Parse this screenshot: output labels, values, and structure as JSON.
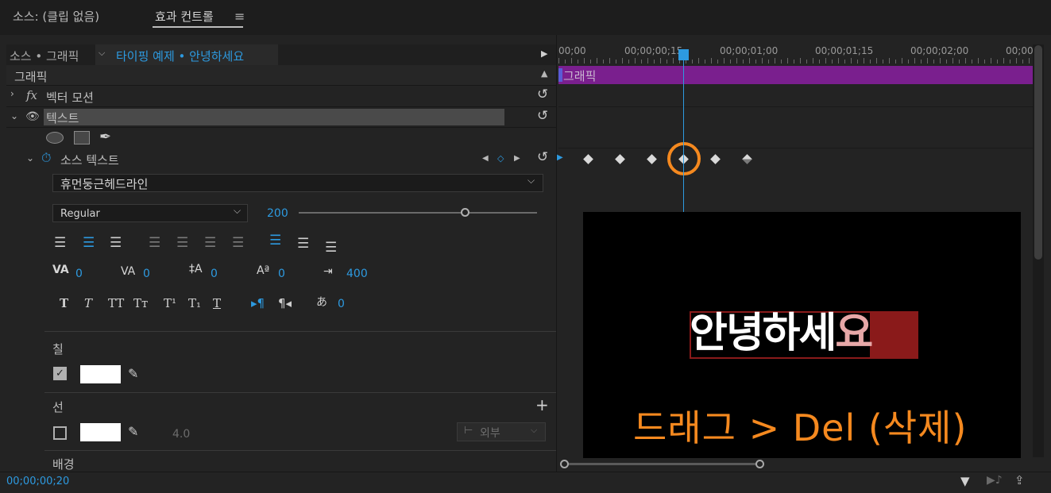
{
  "header": {
    "source_tab": "소스: (클립 없음)",
    "effect_tab": "효과 컨트롤",
    "menu_icon": "≡"
  },
  "panel": {
    "breadcrumb_source": "소스 • 그래픽",
    "breadcrumb_clip": "타이핑 예제 • 안녕하세요",
    "group_label": "그래픽",
    "vector_motion": "벡터 모션",
    "fx_label": "fx",
    "text_label": "텍스트",
    "source_text_label": "소스 텍스트",
    "font_name": "휴먼둥근헤드라인",
    "font_style": "Regular",
    "font_size": "200",
    "font_size_slider": 0.7,
    "tracking": {
      "kerning": "0",
      "tracking": "0",
      "leading": "0",
      "baseline": "0",
      "tab_width": "400",
      "tsume": "0"
    },
    "fill_label": "칠",
    "fill_checked": true,
    "stroke_label": "선",
    "stroke_checked": false,
    "stroke_width": "4.0",
    "stroke_position": "외부",
    "background_label": "배경",
    "timecode": "00;00;00;20"
  },
  "timeline": {
    "ruler": [
      "00;00",
      "00;00;00;15",
      "00;00;01;00",
      "00;00;01;15",
      "00;00;02;00",
      "00;00"
    ],
    "clip_label": "그래픽",
    "clip_color": "#7a1f8e",
    "playhead_color": "#2d9ae0"
  },
  "preview": {
    "title_text_white": "안녕하세",
    "title_text_highlight": "요",
    "instruction": "드래그 > Del (삭제)",
    "instruction_color": "#f5891f",
    "highlight_ring_color": "#f5891f"
  }
}
